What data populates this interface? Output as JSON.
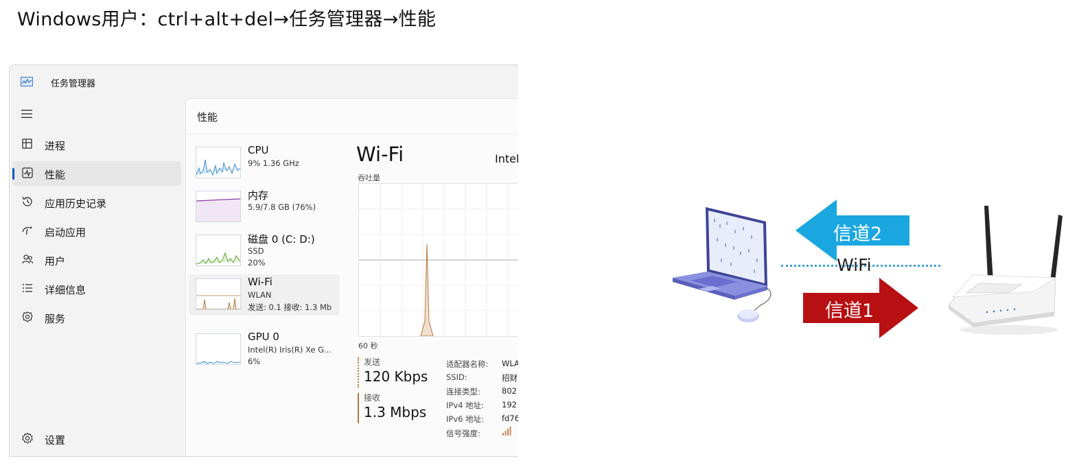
{
  "slide": {
    "title": "Windows用户：ctrl+alt+del→任务管理器→性能"
  },
  "window": {
    "title": "任务管理器"
  },
  "nav": {
    "items": [
      {
        "label": "进程"
      },
      {
        "label": "性能"
      },
      {
        "label": "应用历史记录"
      },
      {
        "label": "启动应用"
      },
      {
        "label": "用户"
      },
      {
        "label": "详细信息"
      },
      {
        "label": "服务"
      }
    ],
    "active": "性能",
    "settings_label": "设置"
  },
  "performance": {
    "header": "性能",
    "items": [
      {
        "name": "CPU",
        "line1": "9%  1.36 GHz",
        "line2": ""
      },
      {
        "name": "内存",
        "line1": "5.9/7.8 GB (76%)",
        "line2": ""
      },
      {
        "name": "磁盘 0 (C: D:)",
        "line1": "SSD",
        "line2": "20%"
      },
      {
        "name": "Wi-Fi",
        "line1": "WLAN",
        "line2": "发送: 0.1  接收: 1.3 Mb"
      },
      {
        "name": "GPU 0",
        "line1": "Intel(R) Iris(R) Xe G...",
        "line2": "6%"
      }
    ],
    "selected": "Wi-Fi"
  },
  "detail": {
    "title": "Wi-Fi",
    "adapter_name": "Intel",
    "throughput_label": "吞吐量",
    "timespan": "60 秒",
    "send": {
      "label": "发送",
      "value": "120 Kbps"
    },
    "receive": {
      "label": "接收",
      "value": "1.3 Mbps"
    },
    "properties": [
      {
        "key": "适配器名称:",
        "value": "WLA"
      },
      {
        "key": "SSID:",
        "value": "招财"
      },
      {
        "key": "连接类型:",
        "value": "802"
      },
      {
        "key": "IPv4 地址:",
        "value": "192"
      },
      {
        "key": "IPv6 地址:",
        "value": "fd76"
      },
      {
        "key": "信号强度:",
        "value": ""
      }
    ]
  },
  "diagram": {
    "channel2_label": "信道2",
    "channel1_label": "信道1",
    "wifi_label": "WiFi",
    "channel2_color": "#1aa7e0",
    "channel1_color": "#b80f12"
  },
  "colors": {
    "accent": "#0a5cc2",
    "cpu_graph": "#3f8fd2",
    "memory_graph": "#8a3ea8",
    "disk_graph": "#5aa02c",
    "wifi_graph": "#b7773e"
  }
}
